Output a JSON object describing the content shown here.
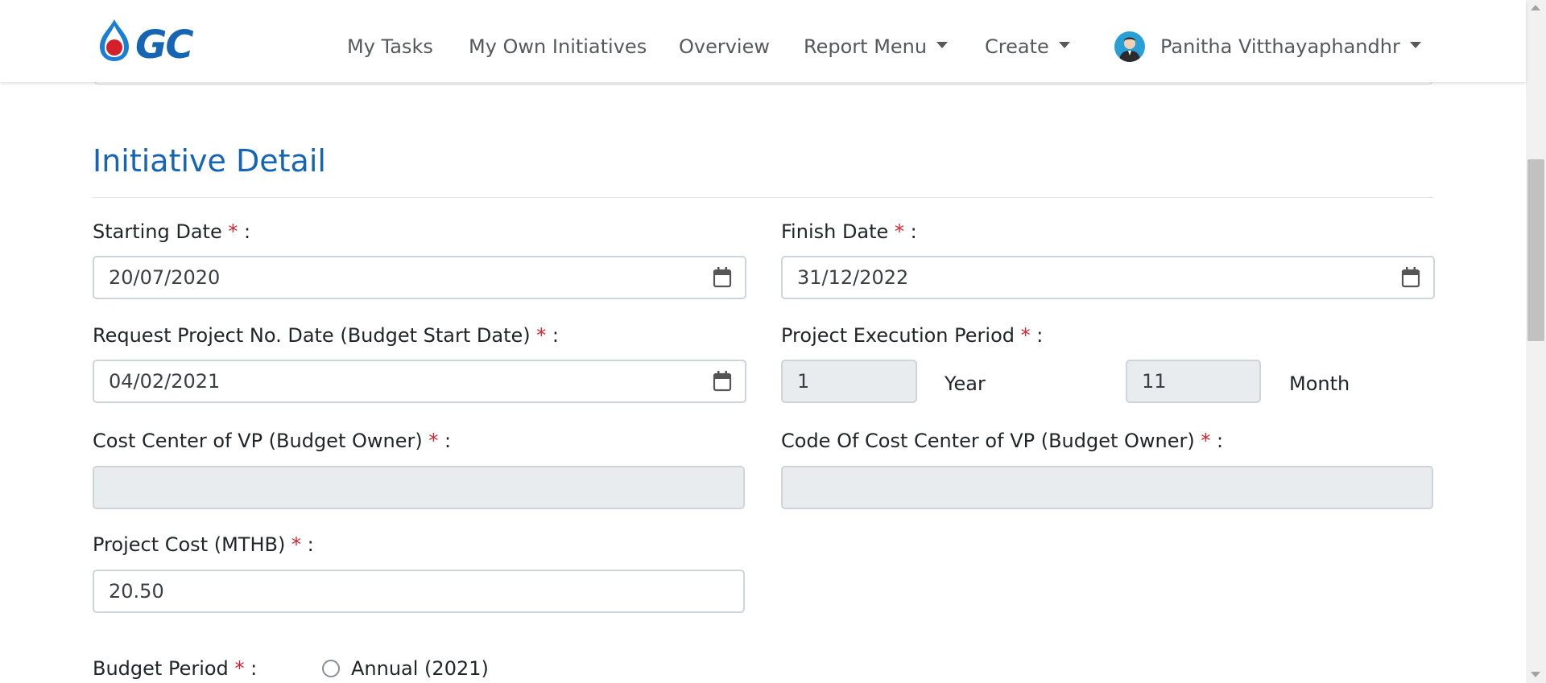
{
  "nav": {
    "items": [
      "My Tasks",
      "My Own Initiatives",
      "Overview"
    ],
    "report_menu": "Report Menu",
    "create": "Create",
    "user_name": "Panitha Vitthayaphandhr"
  },
  "section": {
    "title": "Initiative Detail"
  },
  "form": {
    "required_mark": "*",
    "colon": ":",
    "starting_date": {
      "label": "Starting Date",
      "value": "20/07/2020"
    },
    "finish_date": {
      "label": "Finish Date",
      "value": "31/12/2022"
    },
    "request_date": {
      "label": "Request Project No. Date (Budget Start Date)",
      "value": "04/02/2021"
    },
    "execution_period": {
      "label": "Project Execution Period",
      "years": "1",
      "year_unit": "Year",
      "months": "11",
      "month_unit": "Month"
    },
    "cost_center": {
      "label": "Cost Center of VP (Budget Owner)",
      "value": ""
    },
    "cost_center_code": {
      "label": "Code Of Cost Center of VP (Budget Owner)",
      "value": ""
    },
    "project_cost": {
      "label": "Project Cost (MTHB)",
      "value": "20.50"
    },
    "budget_period": {
      "label": "Budget Period",
      "option": "Annual (2021)",
      "selected": false
    }
  },
  "colors": {
    "accent": "#1565b4",
    "required": "#d9232e",
    "readonly_bg": "#e9ecef"
  }
}
